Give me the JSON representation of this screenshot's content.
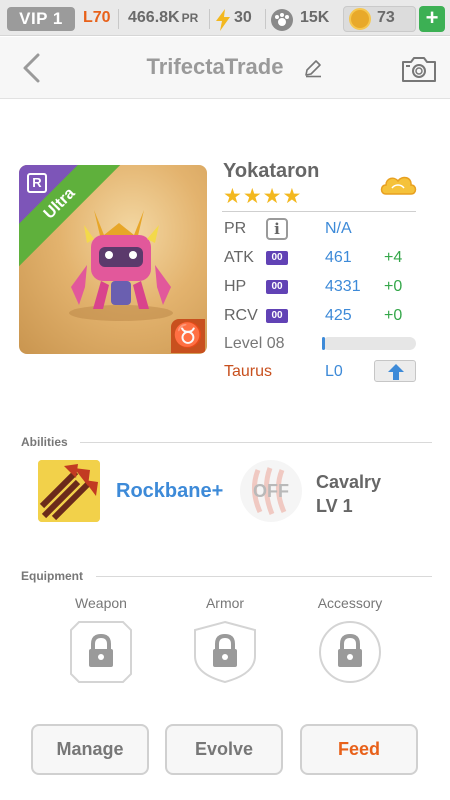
{
  "status": {
    "vip": "VIP 1",
    "level": "L70",
    "pr": "466.8K",
    "pr_label": "PR",
    "energy": "30",
    "food": "15K",
    "gems": "73",
    "plus": "+"
  },
  "header": {
    "title": "TrifectaTrade"
  },
  "monster": {
    "name": "Yokataron",
    "stars": "★★★★",
    "rarity_letter": "R",
    "rarity_label": "Ultra",
    "zodiac_symbol": "♉",
    "stats": {
      "pr_label": "PR",
      "pr_value": "N/A",
      "info": "i",
      "atk_label": "ATK",
      "atk_value": "461",
      "atk_bonus": "+4",
      "hp_label": "HP",
      "hp_value": "4331",
      "hp_bonus": "+0",
      "rcv_label": "RCV",
      "rcv_value": "425",
      "rcv_bonus": "+0",
      "badge": "00",
      "level_label": "Level 08",
      "level_progress": 0.03,
      "zodiac_label": "Taurus",
      "zodiac_level": "L0"
    }
  },
  "abilities": {
    "label": "Abilities",
    "ability1": "Rockbane+",
    "ability2_status": "OFF",
    "ability2_name": "Cavalry",
    "ability2_level": "LV 1"
  },
  "equipment": {
    "label": "Equipment",
    "slots": [
      "Weapon",
      "Armor",
      "Accessory"
    ]
  },
  "buttons": {
    "manage": "Manage",
    "evolve": "Evolve",
    "feed": "Feed"
  },
  "colors": {
    "accent_blue": "#3d8ad8",
    "bonus_green": "#35a74a",
    "feed_orange": "#e8611a",
    "ultra_green": "#5fb03c",
    "rarity_purple": "#7d55b8"
  }
}
